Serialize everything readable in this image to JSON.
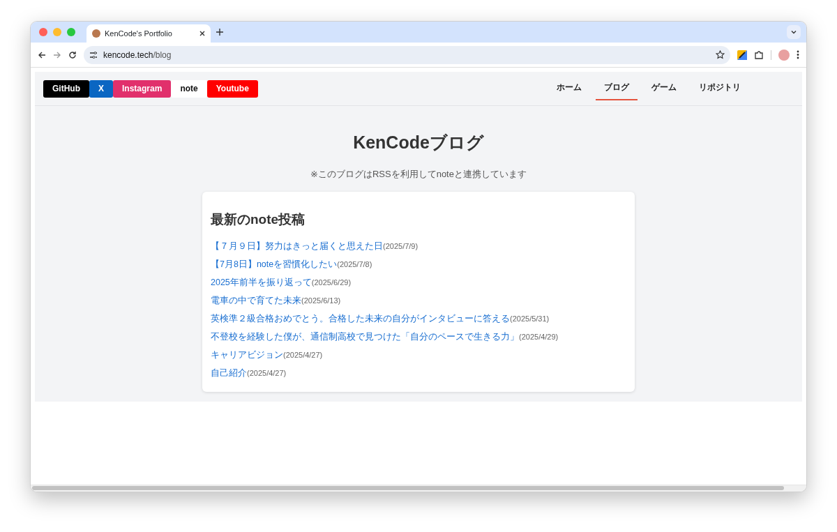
{
  "browser": {
    "tabs": [
      {
        "title": "KenCode's Portfolio",
        "selected": true
      }
    ],
    "url_host": "kencode.tech",
    "url_path": "/blog"
  },
  "social_links": [
    {
      "label": "GitHub",
      "color": "#000000"
    },
    {
      "label": "X",
      "color": "#0a66c2"
    },
    {
      "label": "Instagram",
      "color": "#e1306c"
    },
    {
      "label": "note",
      "color": "#ffffff"
    },
    {
      "label": "Youtube",
      "color": "#ff0000"
    }
  ],
  "nav": [
    {
      "label": "ホーム",
      "selected": false
    },
    {
      "label": "ブログ",
      "selected": true
    },
    {
      "label": "ゲーム",
      "selected": false
    },
    {
      "label": "リポジトリ",
      "selected": false
    }
  ],
  "page": {
    "title": "KenCodeブログ",
    "subtitle": "※このブログはRSSを利用してnoteと連携しています"
  },
  "posts_card": {
    "heading": "最新のnote投稿",
    "posts": [
      {
        "title": "【７月９日】努力はきっと届くと思えた日",
        "date": "(2025/7/9)"
      },
      {
        "title": "【7月8日】noteを習慣化したい",
        "date": "(2025/7/8)"
      },
      {
        "title": "2025年前半を振り返って",
        "date": "(2025/6/29)"
      },
      {
        "title": "電車の中で育てた未来",
        "date": "(2025/6/13)"
      },
      {
        "title": "英検準２級合格おめでとう。合格した未来の自分がインタビューに答える",
        "date": "(2025/5/31)"
      },
      {
        "title": "不登校を経験した僕が、通信制高校で見つけた「自分のペースで生きる力」",
        "date": "(2025/4/29)"
      },
      {
        "title": "キャリアビジョン",
        "date": "(2025/4/27)"
      },
      {
        "title": "自己紹介",
        "date": "(2025/4/27)"
      }
    ]
  }
}
